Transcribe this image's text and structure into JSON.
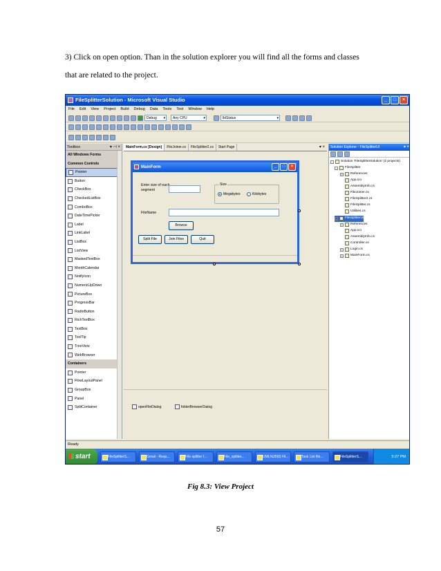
{
  "doc": {
    "paragraph_line1": "3) Click on open option. Than in the solution explorer you will find all the forms and classes",
    "paragraph_line2": "that are related to the project.",
    "caption": "Fig 8.3: View Project",
    "page_number": "57"
  },
  "screenshot": {
    "window_title": "FileSplitterSolution - Microsoft Visual Studio",
    "menu": [
      "File",
      "Edit",
      "View",
      "Project",
      "Build",
      "Debug",
      "Data",
      "Tools",
      "Test",
      "Window",
      "Help"
    ],
    "toolbar": {
      "config": "Debug",
      "platform": "Any CPU",
      "find": "lblStatus"
    },
    "toolbox": {
      "title": "Toolbox",
      "items": [
        "All Windows Forms",
        "Common Controls",
        "Pointer",
        "Button",
        "CheckBox",
        "CheckedListBox",
        "ComboBox",
        "DateTimePicker",
        "Label",
        "LinkLabel",
        "ListBox",
        "ListView",
        "MaskedTextBox",
        "MonthCalendar",
        "NotifyIcon",
        "NumericUpDown",
        "PictureBox",
        "ProgressBar",
        "RadioButton",
        "RichTextBox",
        "TextBox",
        "ToolTip",
        "TreeView",
        "WebBrowser",
        "Containers",
        "Pointer",
        "FlowLayoutPanel",
        "GroupBox",
        "Panel",
        "SplitContainer"
      ]
    },
    "tabs": [
      "MainForm.cs [Design]",
      "FileJoiner.cs",
      "FileSplitter2.cs",
      "Start Page"
    ],
    "form": {
      "title": "MainForm",
      "size_label": "Enter size of each segment",
      "group_label": "Size",
      "radio_mb": "Megabytes",
      "radio_kb": "Kilobytes",
      "filename_label": "FileName",
      "browse": "Browse",
      "split": "Split File",
      "join": "Join Files",
      "quit": "Quit"
    },
    "tray": [
      "openFileDialog",
      "folderBrowserDialog"
    ],
    "solution_explorer": {
      "title": "Solution Explorer - FileSplitterUI",
      "nodes": [
        "Solution 'FileSplitterSolution' (2 projects)",
        "FileSplitter",
        "References",
        "App.ico",
        "AssemblyInfo.cs",
        "FileJoiner.cs",
        "FileSplitter2.cs",
        "FileSplitter.cs",
        "Utilities.cs",
        "FileSplitterUI",
        "References",
        "App.ico",
        "AssemblyInfo.cs",
        "Controller.cs",
        "Login.cs",
        "MainForm.cs"
      ]
    },
    "status": "Ready",
    "taskbar": {
      "start": "start",
      "tasks": [
        "FileSplitterS...",
        "Gmail - Requ...",
        "File splitter f...",
        "File_splitter...",
        "UML%20(0) Fil...",
        "Task List file...",
        "FileSplitterS..."
      ],
      "clock": "5:27 PM"
    },
    "colors": {
      "titlebar": "#0a54e0",
      "taskbar": "#1f5ee0",
      "start": "#2f8a2f"
    }
  }
}
